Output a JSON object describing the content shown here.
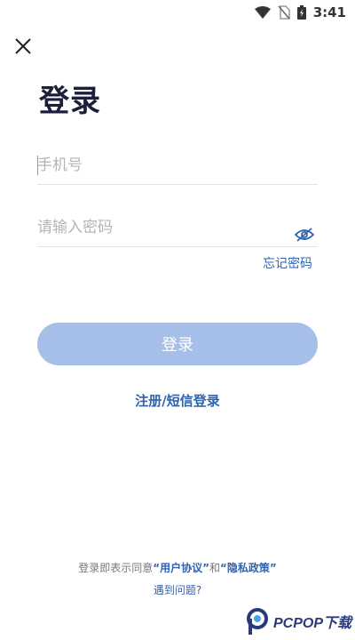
{
  "status_bar": {
    "time": "3:41",
    "icons": [
      "wifi-icon",
      "no-sim-icon",
      "battery-charging-icon"
    ]
  },
  "header": {
    "close_icon": "close-icon",
    "title": "登录"
  },
  "form": {
    "phone_placeholder": "手机号",
    "password_placeholder": "请输入密码",
    "password_toggle_icon": "eye-icon",
    "forgot_label": "忘记密码",
    "login_label": "登录",
    "register_label": "注册/短信登录"
  },
  "footer": {
    "agreement_prefix": "登录即表示同意",
    "agreement_user_link": "“用户协议”",
    "agreement_and": "和",
    "agreement_privacy_link": "“隐私政策”",
    "help_label": "遇到问题?"
  },
  "watermark": {
    "text": "PCPOP下载"
  },
  "colors": {
    "title": "#1b1f3b",
    "link": "#2f63b0",
    "button_disabled": "#a6bfe9",
    "placeholder": "#b4b4b4"
  }
}
